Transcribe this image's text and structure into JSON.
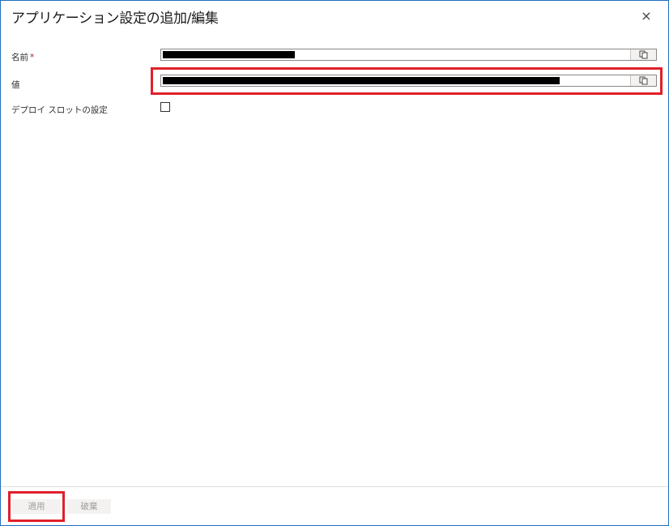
{
  "dialog": {
    "title": "アプリケーション設定の追加/編集",
    "close_glyph": "×"
  },
  "fields": {
    "name_label": "名前",
    "required_marker": "*",
    "value_label": "値",
    "deploy_slot_label": "デプロイ スロットの設定",
    "deploy_slot_checked": false
  },
  "icons": {
    "close": "close-icon",
    "copy": "copy-icon",
    "checkbox": "checkbox-unchecked"
  },
  "buttons": {
    "apply_label": "適用",
    "discard_label": "破棄"
  },
  "colors": {
    "highlight": "#e0202a",
    "border_accent": "#1f6fbf",
    "disabled_text": "#a19f9d"
  }
}
